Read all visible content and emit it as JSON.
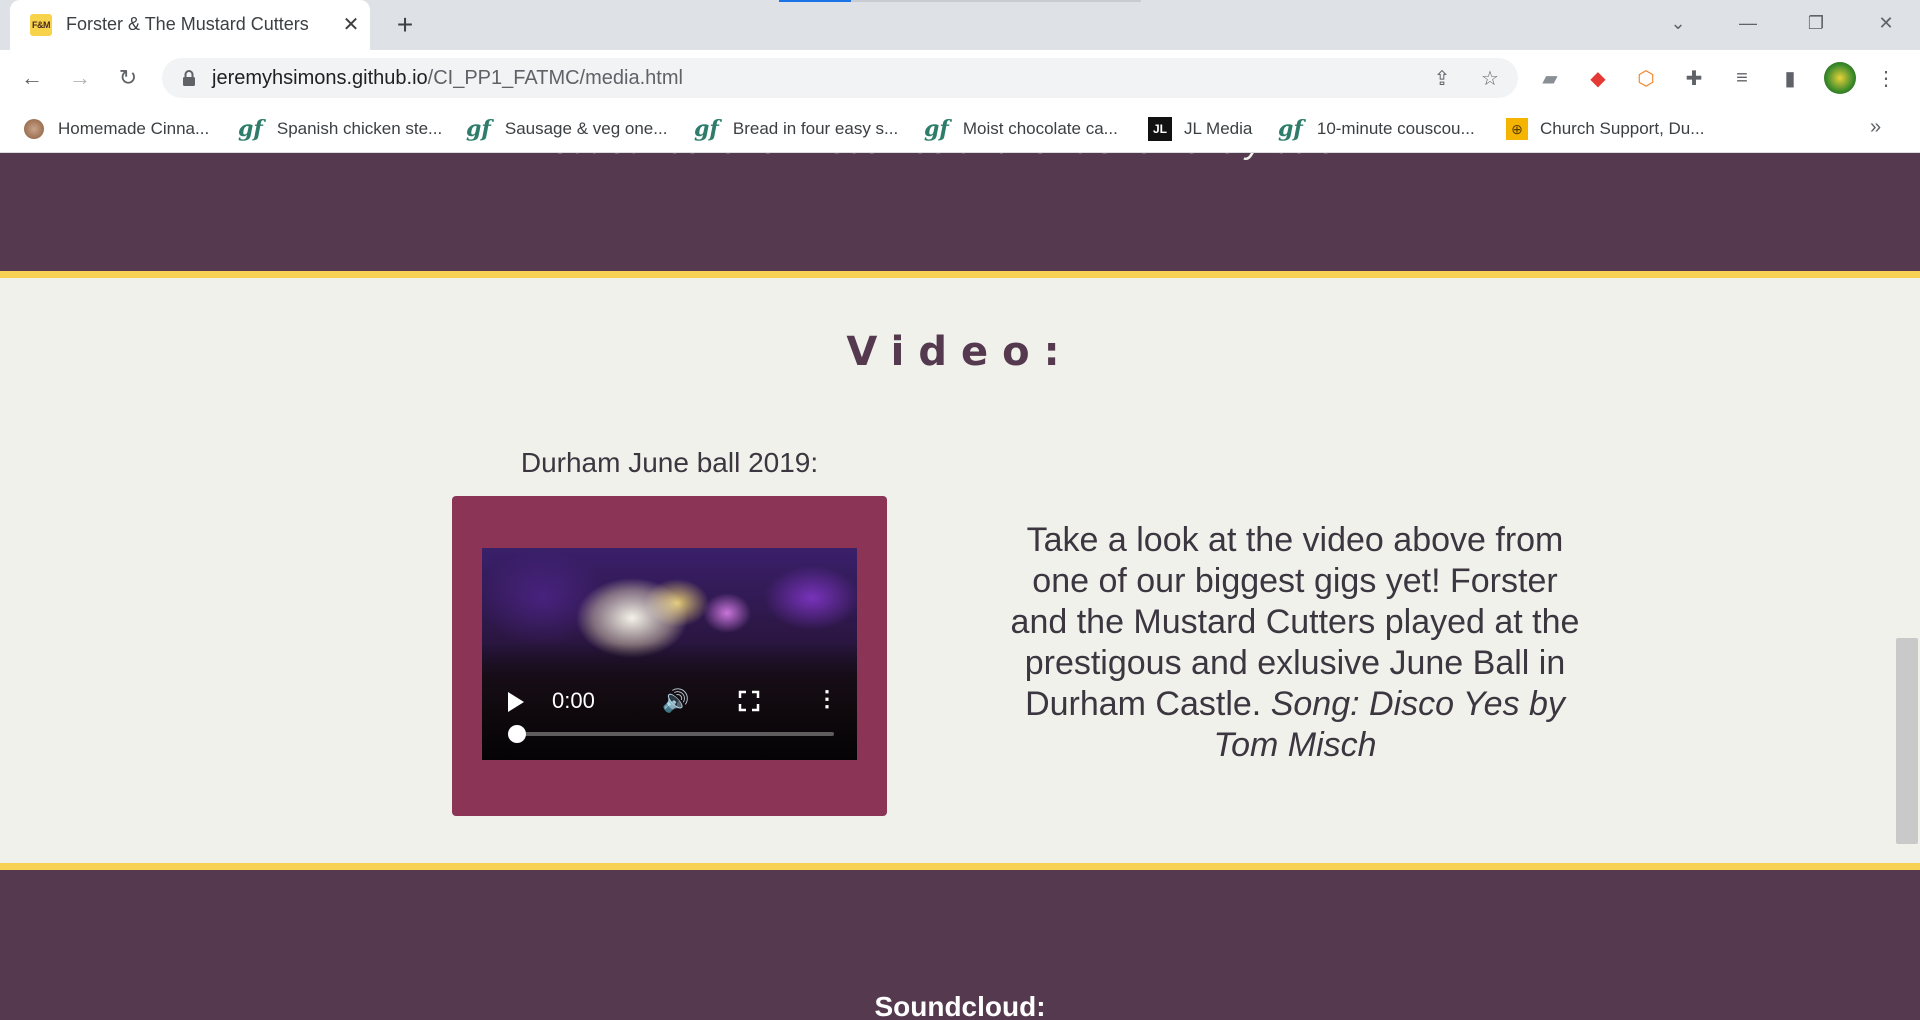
{
  "browser": {
    "tab_title": "Forster & The Mustard Cutters",
    "tab_favicon_text": "F&M",
    "url_host": "jeremyhsimons.github.io",
    "url_path": "/CI_PP1_FATMC/media.html"
  },
  "bookmarks": [
    {
      "label": "Homemade Cinna...",
      "icon": "food-photo-icon"
    },
    {
      "label": "Spanish chicken ste...",
      "icon": "gf-icon"
    },
    {
      "label": "Sausage & veg one...",
      "icon": "gf-icon"
    },
    {
      "label": "Bread in four easy s...",
      "icon": "gf-icon"
    },
    {
      "label": "Moist chocolate ca...",
      "icon": "gf-icon"
    },
    {
      "label": "JL Media",
      "icon": "jl-icon"
    },
    {
      "label": "10-minute couscou...",
      "icon": "gf-icon"
    },
    {
      "label": "Church Support, Du...",
      "icon": "church-icon"
    }
  ],
  "bookmark_icon_text": {
    "gf": "gf",
    "jl": "JL"
  },
  "page": {
    "cut_off_text": "out our cover of Disco Yes and Isn't She Lovely below.",
    "video_heading": "Video:",
    "video_title": "Durham June ball 2019:",
    "video_time": "0:00",
    "video_progress": 0,
    "video_desc_plain": "Take a look at the video above from one of our biggest gigs yet! Forster and the Mustard Cutters played at the prestigous and exlusive June Ball in Durham Castle.",
    "video_desc_italic": "Song: Disco Yes by Tom Misch",
    "soundcloud_heading": "Soundcloud:"
  },
  "colors": {
    "purple": "#553a4f",
    "gold": "#f7d154",
    "light_bg": "#f0f1ea",
    "frame": "#8c3456"
  }
}
